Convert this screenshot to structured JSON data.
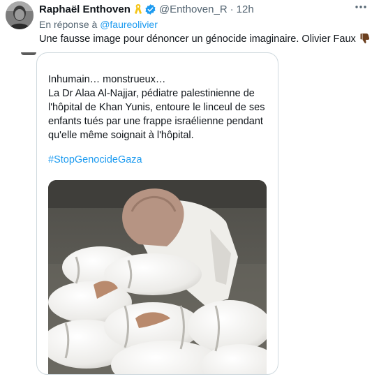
{
  "tweet": {
    "author_name": "Raphaël Enthoven",
    "ribbon_icon": "yellow-ribbon-icon",
    "verified_icon": "verified-badge-icon",
    "handle": "@Enthoven_R",
    "separator": "·",
    "time": "12h",
    "reply_prefix": "En réponse à",
    "reply_mention": "@faureolivier",
    "text": "Une fausse image pour dénoncer un génocide imaginaire. Olivier Faux",
    "text_emoji": "thumbs-down-icon",
    "more_icon": "more-options-icon"
  },
  "quoted": {
    "lines": [
      "Inhumain… monstrueux…",
      "La Dr Alaa Al-Najjar, pédiatre palestinienne de",
      "l'hôpital de Khan Yunis, entoure le linceul de ses",
      "enfants tués par une frappe israélienne pendant",
      "qu'elle même soignait à l'hôpital."
    ],
    "hashtag": "#StopGenocideGaza"
  },
  "colors": {
    "link": "#1d9bf0",
    "ribbon": "#f5c518",
    "verified": "#1d9bf0",
    "secondary_text": "#536471",
    "border": "#cfd9de"
  }
}
